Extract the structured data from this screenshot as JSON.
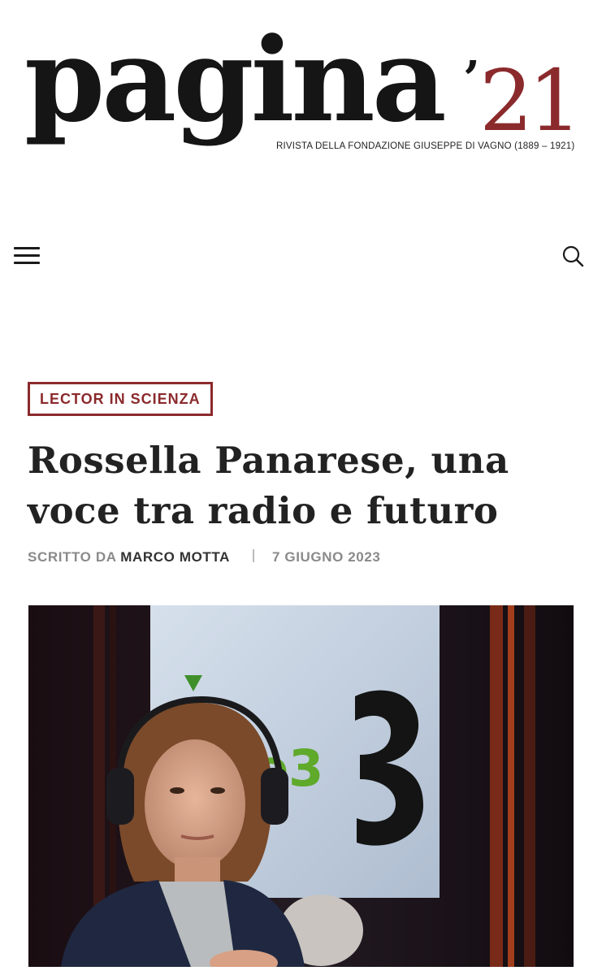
{
  "site": {
    "logo_word": "pagina",
    "logo_apostrophe": "’",
    "logo_number": "21",
    "tagline": "RIVISTA DELLA FONDAZIONE GIUSEPPE DI VAGNO (1889 – 1921)",
    "brand_color": "#8b2a2c"
  },
  "nav": {
    "menu_icon": "hamburger-menu-icon",
    "search_icon": "search-icon"
  },
  "article": {
    "category": "LECTOR IN SCIENZA",
    "title": "Rossella Panarese, una voce tra radio e futuro",
    "byline_prefix": "SCRITTO DA",
    "author": "MARCO MOTTA",
    "date": "7 GIUGNO 2023"
  },
  "hero_image": {
    "studio_sign": "adio3"
  }
}
